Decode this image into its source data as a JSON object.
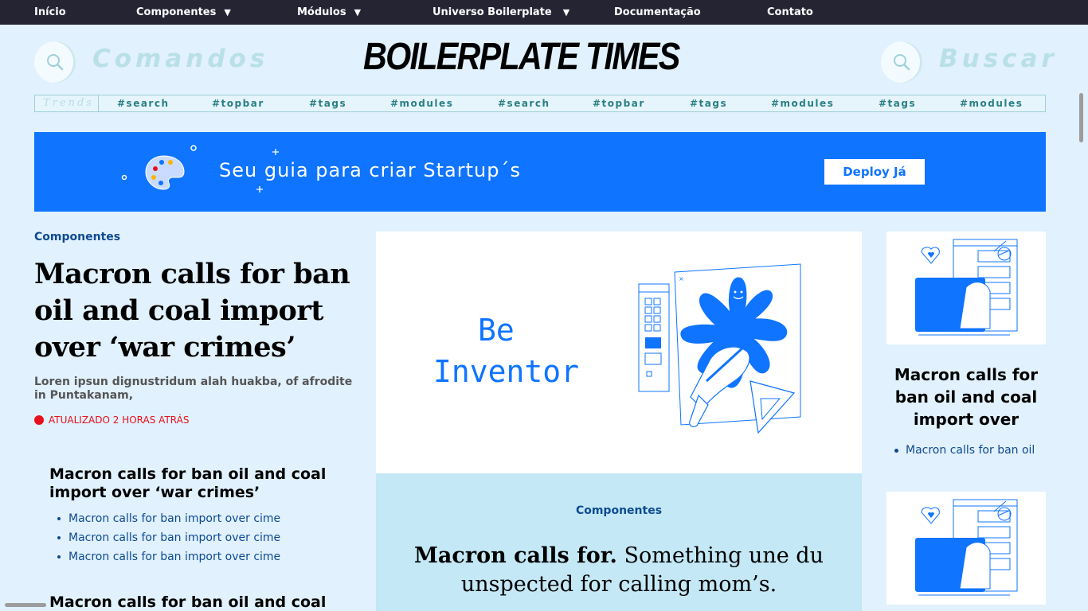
{
  "nav": {
    "items": [
      {
        "label": "Início",
        "dropdown": false
      },
      {
        "label": "Componentes",
        "dropdown": true
      },
      {
        "label": "Módulos",
        "dropdown": true
      },
      {
        "label": "Universo Boilerplate",
        "dropdown": true
      },
      {
        "label": "Documentação",
        "dropdown": false
      },
      {
        "label": "Contato",
        "dropdown": false
      }
    ],
    "caret": "▼"
  },
  "header": {
    "left_label": "Comandos",
    "masthead": "BOILERPLATE TIMES",
    "right_label": "Buscar"
  },
  "trends": {
    "label": "Trends",
    "tags": [
      "#search",
      "#topbar",
      "#tags",
      "#modules",
      "#search",
      "#topbar",
      "#tags",
      "#modules",
      "#tags",
      "#modules"
    ]
  },
  "banner": {
    "slogan": "Seu guia para criar Startup´s",
    "cta": "Deploy Já"
  },
  "left": {
    "category": "Componentes",
    "headline": "Macron calls for ban oil and coal import over ‘war crimes’",
    "lead": "Loren ipsun dignustridum alah huakba, of afrodite in Puntakanam,",
    "updated": "ATUALIZADO 2 HORAS ATRÁS",
    "sub1": {
      "title": "Macron calls for ban oil and coal import over ‘war crimes’",
      "links": [
        "Macron calls for ban import over cime",
        "Macron calls for ban import over cime",
        "Macron calls for ban import over cime"
      ]
    },
    "sub2_title": "Macron calls for ban oil and coal"
  },
  "feature": {
    "art_line1": "Be",
    "art_line2": "Inventor",
    "category": "Componentes",
    "text_bold": "Macron calls for.",
    "text_rest": " Something une du unspected for calling mom’s."
  },
  "right": {
    "title": "Macron calls for ban oil and coal import over",
    "links": [
      "Macron calls for ban oil"
    ]
  },
  "colors": {
    "accent": "#0f74ff",
    "nav_bg": "#242433",
    "page_bg": "#e1f1fd",
    "link": "#0d4a91",
    "alert": "#e8101c"
  },
  "icons": [
    "search-icon",
    "caret-down-icon",
    "palette-icon",
    "be-inventor-illustration",
    "laptop-illustration"
  ]
}
